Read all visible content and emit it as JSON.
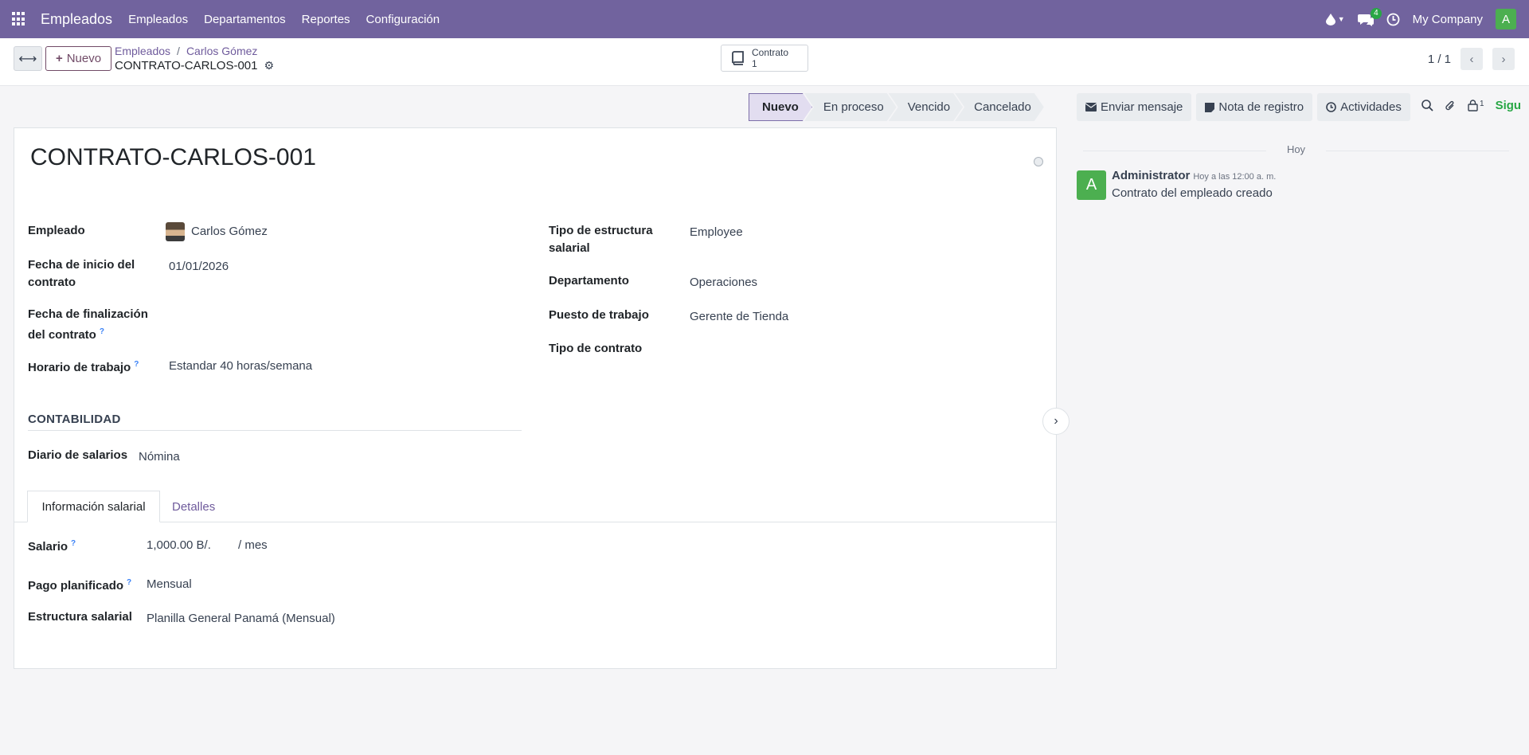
{
  "navbar": {
    "app_name": "Empleados",
    "menu": [
      "Empleados",
      "Departamentos",
      "Reportes",
      "Configuración"
    ],
    "messages_count": "4",
    "company": "My Company",
    "user_initial": "A"
  },
  "control": {
    "new_label": "Nuevo",
    "breadcrumb": [
      "Empleados",
      "Carlos Gómez"
    ],
    "record_name": "CONTRATO-CARLOS-001",
    "smart_button": {
      "label": "Contrato",
      "count": "1"
    },
    "pager": "1 / 1"
  },
  "statusbar": {
    "stages": [
      "Nuevo",
      "En proceso",
      "Vencido",
      "Cancelado"
    ],
    "current": "Nuevo"
  },
  "form": {
    "title": "CONTRATO-CARLOS-001",
    "left": {
      "employee_label": "Empleado",
      "employee_value": "Carlos Gómez",
      "start_label": "Fecha de inicio del contrato",
      "start_value": "01/01/2026",
      "end_label": "Fecha de finalización del contrato",
      "schedule_label": "Horario de trabajo",
      "schedule_value": "Estandar 40 horas/semana"
    },
    "right": {
      "structure_type_label": "Tipo de estructura salarial",
      "structure_type_value": "Employee",
      "department_label": "Departamento",
      "department_value": "Operaciones",
      "job_label": "Puesto de trabajo",
      "job_value": "Gerente de Tienda",
      "contract_type_label": "Tipo de contrato"
    },
    "accounting": {
      "section_title": "CONTABILIDAD",
      "journal_label": "Diario de salarios",
      "journal_value": "Nómina"
    },
    "tabs": [
      "Información salarial",
      "Detalles"
    ],
    "salary": {
      "wage_label": "Salario",
      "wage_value": "1,000.00 B/.",
      "wage_period": "/ mes",
      "schedule_pay_label": "Pago planificado",
      "schedule_pay_value": "Mensual",
      "structure_label": "Estructura salarial",
      "structure_value": "Planilla General Panamá (Mensual)"
    },
    "help_mark": "?"
  },
  "chatter": {
    "send_message": "Enviar mensaje",
    "log_note": "Nota de registro",
    "activities": "Actividades",
    "followers_count": "1",
    "follow": "Sigu",
    "date_separator": "Hoy",
    "message": {
      "avatar": "A",
      "author": "Administrator",
      "time": "Hoy a las 12:00 a. m.",
      "body": "Contrato del empleado creado"
    }
  }
}
